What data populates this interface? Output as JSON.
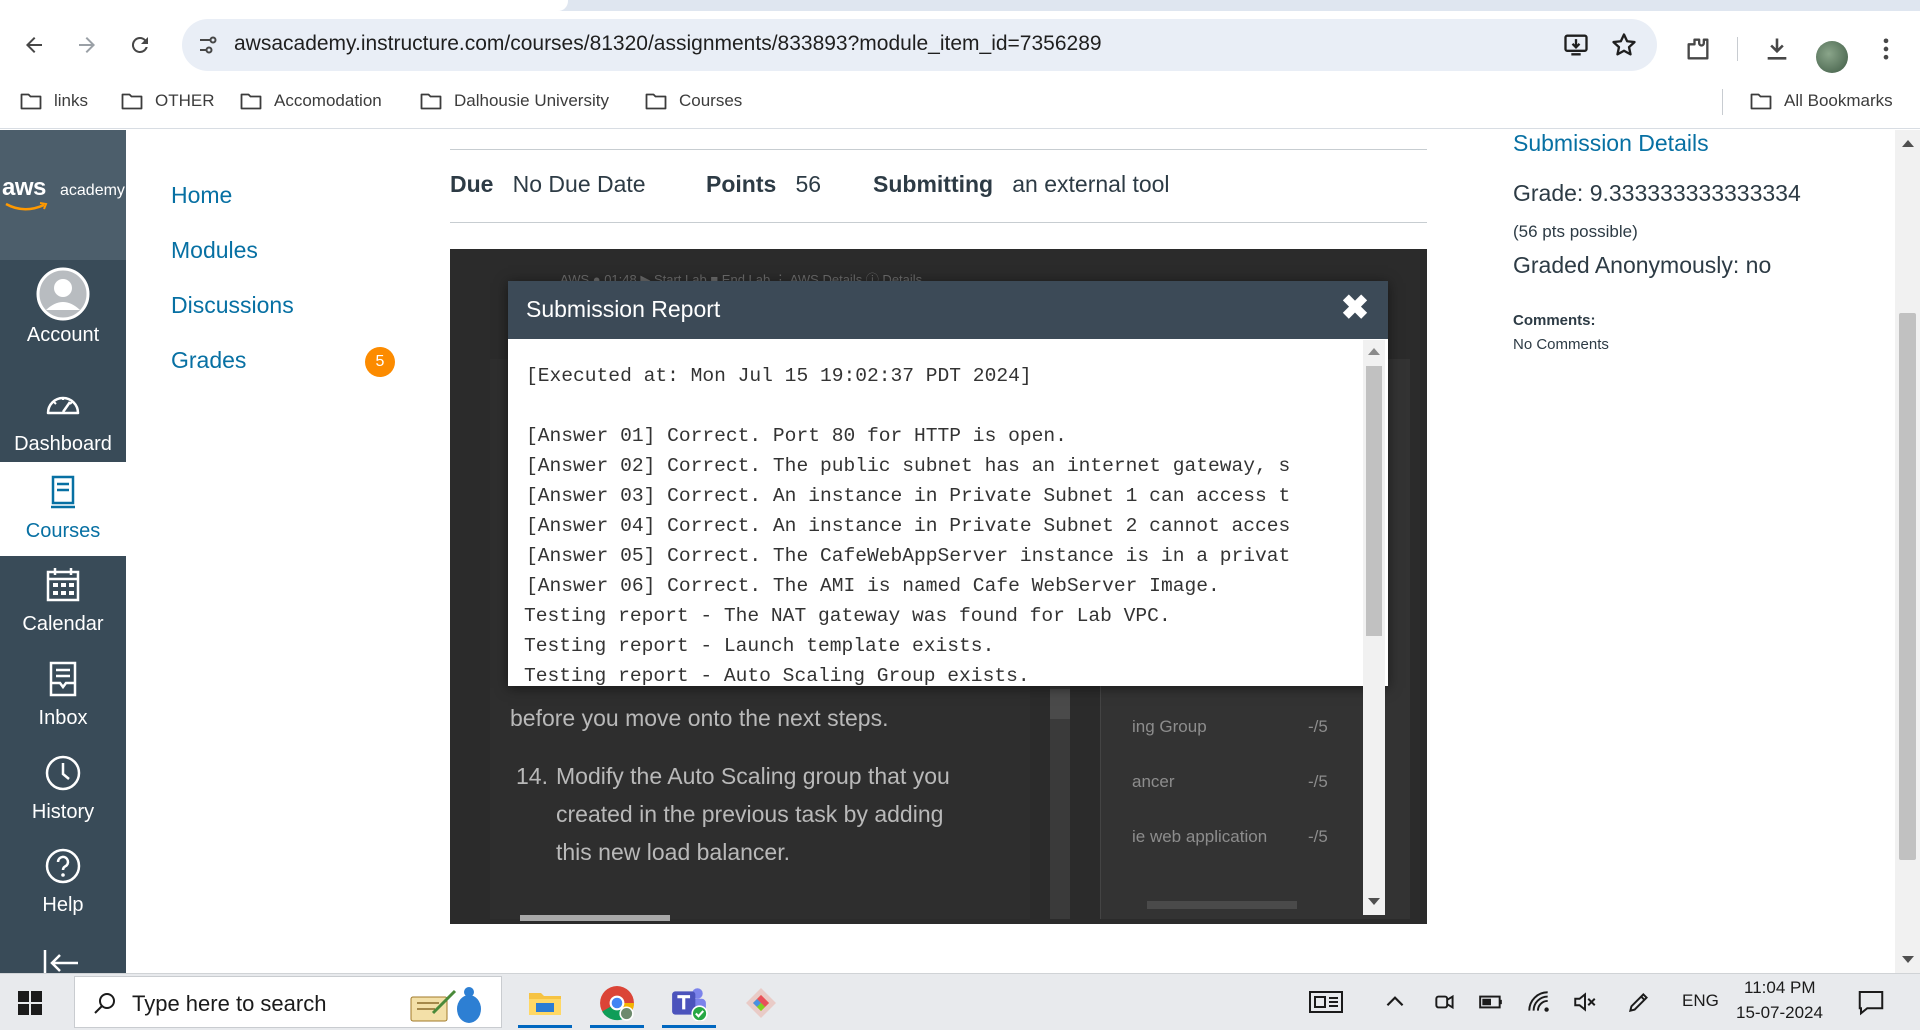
{
  "browser": {
    "url_host": "awsacademy.instructure.com",
    "url_path": "/courses/81320/assignments/833893?module_item_id=7356289",
    "bookmarks": [
      "links",
      "OTHER",
      "Accomodation",
      "Dalhousie University",
      "Courses"
    ],
    "all_bookmarks": "All Bookmarks"
  },
  "global_nav": {
    "brand": "aws",
    "brand_sub": "academy",
    "items": [
      {
        "label": "Account",
        "icon": "account-avatar-icon"
      },
      {
        "label": "Dashboard",
        "icon": "dashboard-gauge-icon"
      },
      {
        "label": "Courses",
        "icon": "courses-book-icon"
      },
      {
        "label": "Calendar",
        "icon": "calendar-icon"
      },
      {
        "label": "Inbox",
        "icon": "inbox-icon"
      },
      {
        "label": "History",
        "icon": "history-clock-icon"
      },
      {
        "label": "Help",
        "icon": "help-icon"
      }
    ]
  },
  "course_nav": {
    "items": [
      "Home",
      "Modules",
      "Discussions",
      "Grades"
    ],
    "grades_badge": "5"
  },
  "assignment": {
    "due_label": "Due",
    "due_value": "No Due Date",
    "points_label": "Points",
    "points_value": "56",
    "submitting_label": "Submitting",
    "submitting_value": "an external tool"
  },
  "lab_background": {
    "toolbar_ghost": "AWS ●        01:48        ▶ Start Lab        ■ End Lab        ⋮ AWS Details        ⓘ Details",
    "text_line_1": "before you move onto the next steps.",
    "step_num": "14.",
    "step_line_1": "Modify the Auto Scaling group that you",
    "step_line_2": "created in the previous task by adding",
    "step_line_3": "this new load balancer.",
    "grade_rows": [
      {
        "label": "ing Group",
        "score": "-/5"
      },
      {
        "label": "ancer",
        "score": "-/5"
      },
      {
        "label": "ie web application",
        "score": "-/5"
      }
    ]
  },
  "modal": {
    "title": "Submission Report",
    "lines": [
      "[Executed at: Mon Jul 15 19:02:37 PDT 2024]",
      "",
      "[Answer 01] Correct. Port 80 for HTTP is open.",
      "[Answer 02] Correct. The public subnet has an internet gateway, s",
      "[Answer 03] Correct. An instance in Private Subnet 1 can access t",
      "[Answer 04] Correct. An instance in Private Subnet 2 cannot acces",
      "[Answer 05] Correct. The CafeWebAppServer instance is in a privat",
      "[Answer 06] Correct. The AMI is named Cafe WebServer Image.",
      "Testing report - The NAT gateway was found for Lab VPC.",
      "Testing report - Launch template exists.",
      "Testing report - Auto Scaling Group exists."
    ]
  },
  "submission_details": {
    "title": "Submission Details",
    "grade": "Grade: 9.333333333333334",
    "possible": "(56 pts possible)",
    "anonymous": "Graded Anonymously: no",
    "comments_label": "Comments:",
    "comments_value": "No Comments"
  },
  "taskbar": {
    "search_placeholder": "Type here to search",
    "language": "ENG",
    "time": "11:04 PM",
    "date": "15-07-2024"
  }
}
